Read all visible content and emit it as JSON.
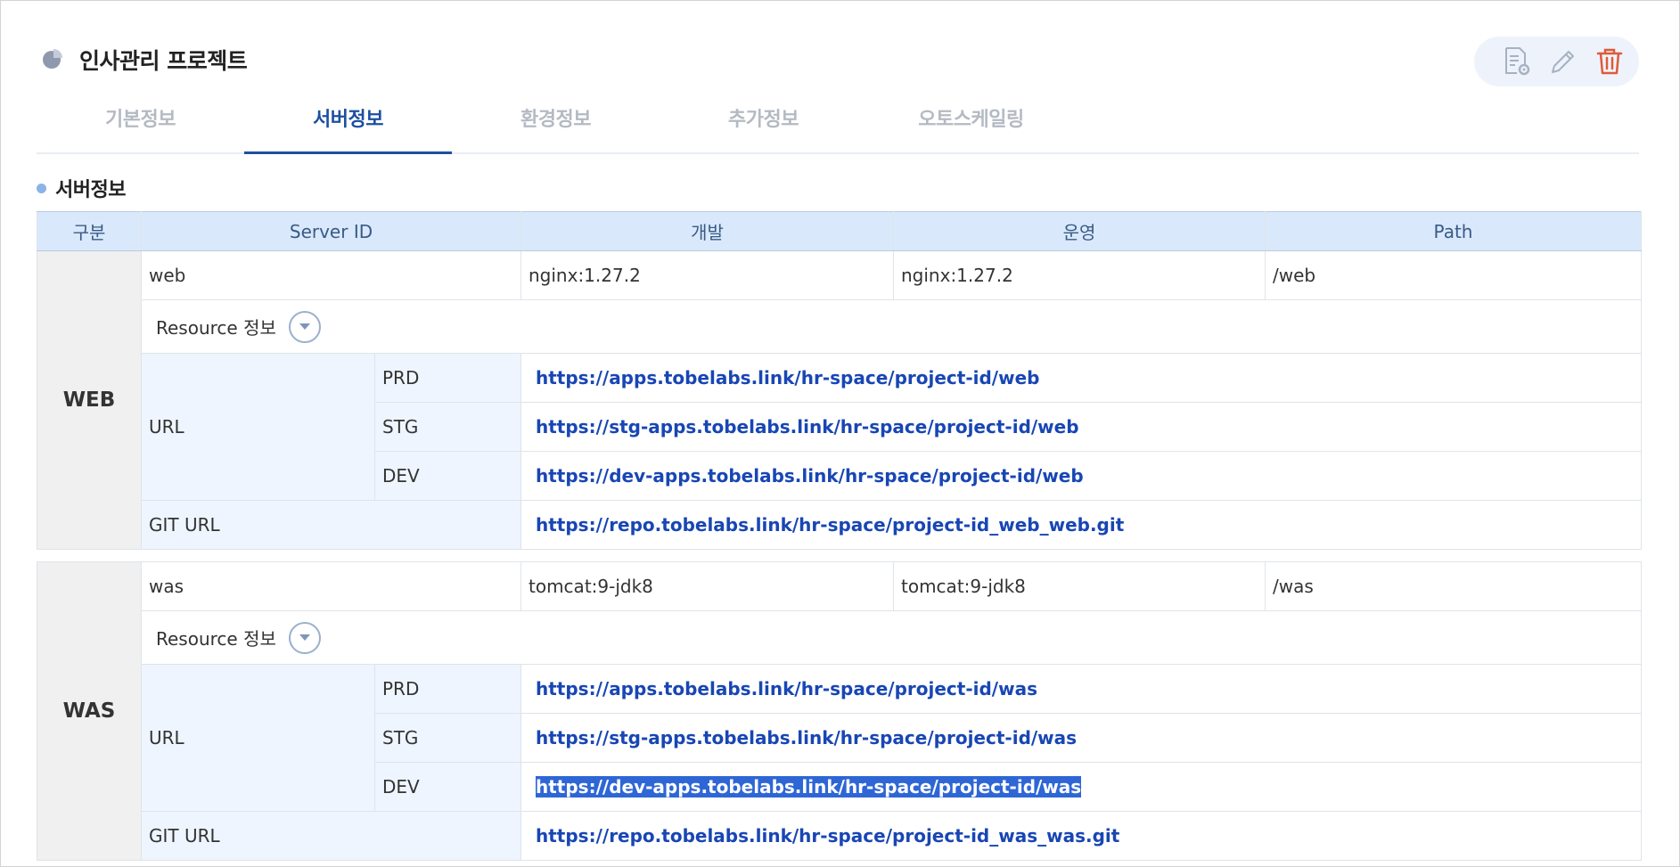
{
  "project": {
    "title": "인사관리 프로젝트",
    "icon": "pie-chart-icon"
  },
  "actions": [
    {
      "name": "settings-doc-icon"
    },
    {
      "name": "edit-icon"
    },
    {
      "name": "delete-icon",
      "color": "#e05a38"
    }
  ],
  "tabs": [
    {
      "label": "기본정보",
      "active": false
    },
    {
      "label": "서버정보",
      "active": true
    },
    {
      "label": "환경정보",
      "active": false
    },
    {
      "label": "추가정보",
      "active": false
    },
    {
      "label": "오토스케일링",
      "active": false
    }
  ],
  "section": {
    "title": "서버정보"
  },
  "table": {
    "headers": [
      "구분",
      "Server ID",
      "개발",
      "운영",
      "Path"
    ],
    "groups": [
      {
        "label": "WEB",
        "server_id": "web",
        "dev": "nginx:1.27.2",
        "prod": "nginx:1.27.2",
        "path": "/web",
        "resource_label": "Resource 정보",
        "url_label": "URL",
        "urls": [
          {
            "env": "PRD",
            "url": "https://apps.tobelabs.link/hr-space/project-id/web"
          },
          {
            "env": "STG",
            "url": "https://stg-apps.tobelabs.link/hr-space/project-id/web"
          },
          {
            "env": "DEV",
            "url": "https://dev-apps.tobelabs.link/hr-space/project-id/web"
          }
        ],
        "git_label": "GIT URL",
        "git_url": "https://repo.tobelabs.link/hr-space/project-id_web_web.git"
      },
      {
        "label": "WAS",
        "server_id": "was",
        "dev": "tomcat:9-jdk8",
        "prod": "tomcat:9-jdk8",
        "path": "/was",
        "resource_label": "Resource 정보",
        "url_label": "URL",
        "urls": [
          {
            "env": "PRD",
            "url": "https://apps.tobelabs.link/hr-space/project-id/was"
          },
          {
            "env": "STG",
            "url": "https://stg-apps.tobelabs.link/hr-space/project-id/was"
          },
          {
            "env": "DEV",
            "url": "https://dev-apps.tobelabs.link/hr-space/project-id/was",
            "selected": true
          }
        ],
        "git_label": "GIT URL",
        "git_url": "https://repo.tobelabs.link/hr-space/project-id_was_was.git"
      }
    ]
  },
  "colors": {
    "accent": "#1d4fa0",
    "link": "#1846b4",
    "header_bg": "#d9e9fb",
    "delete": "#e05a38"
  }
}
